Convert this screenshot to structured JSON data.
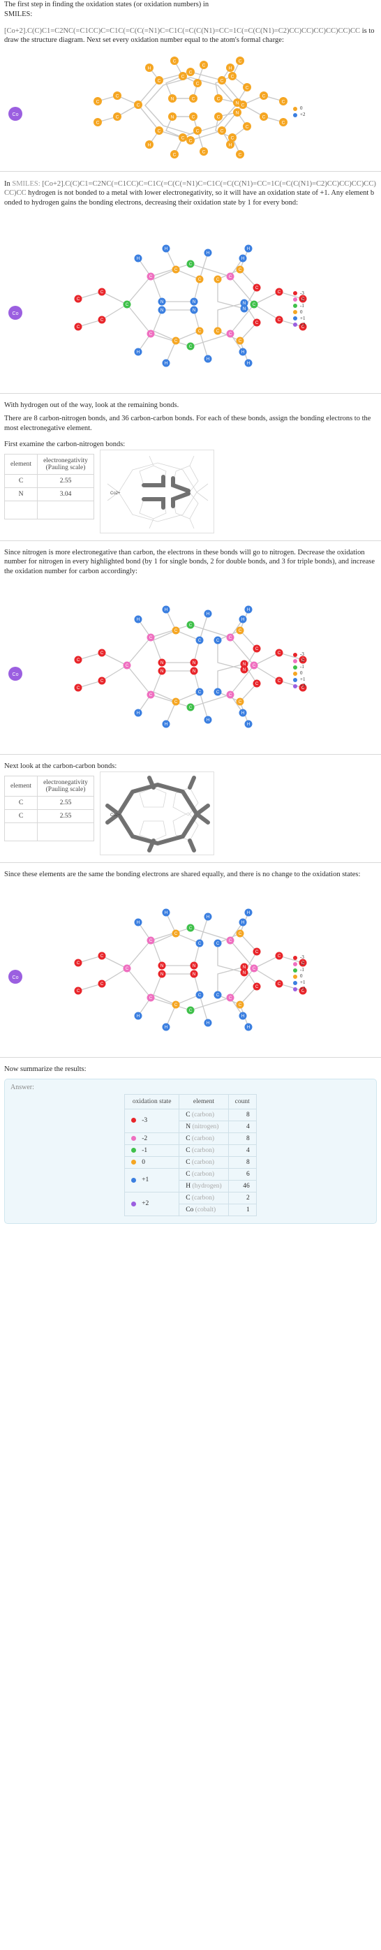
{
  "steps": {
    "step1": {
      "intro": "The first step in finding the oxidation states (or oxidation numbers) in",
      "smiles_label": "SMILES:",
      "smiles": "[Co+2].C(C)C1=C2NC(=C1CC)C=C1C(=C(C(=N1)C=C1C(=C(C(N1)=CC=1C(=C(C(N1)=C2)CC)CC)CC)CC)CC)CC",
      "tail": "is to draw the structure diagram. Next set every oxidation number equal to the atom's formal charge:"
    },
    "step2": {
      "line1_a": "In",
      "line1_smiles_label": "SMILES:",
      "line1_smiles": "[Co+2].C(C)C1=C2NC(=C1CC)C=C1C(=C(C(=N1)C=C1C(=C(C(N1)=CC=1C(=C(C(N1)=C2)CC)CC)CC)CC)CC)CC",
      "line1_b": "hydrogen is not bonded to a metal with lower electronegativity, so it will have an oxidation state of +1. Any element bonded to hydrogen gains the bonding electrons, decreasing their oxidation state by 1 for every bond:"
    },
    "step3": {
      "p1": "With hydrogen out of the way, look at the remaining bonds.",
      "p2": "There are 8 carbon-nitrogen bonds, and 36 carbon-carbon bonds.  For each of these bonds, assign the bonding electrons to the most electronegative element.",
      "p3": "First examine the carbon-nitrogen bonds:"
    },
    "step4": {
      "p1": "Since nitrogen is more electronegative than carbon, the electrons in these bonds will go to nitrogen. Decrease the oxidation number for nitrogen in every highlighted bond (by 1 for single bonds, 2 for double bonds, and 3 for triple bonds), and increase the oxidation number for carbon accordingly:"
    },
    "step5": {
      "p1": "Next look at the carbon-carbon bonds:"
    },
    "step6": {
      "p1": "Since these elements are the same the bonding electrons are shared equally, and there is no change to the oxidation states:"
    },
    "step7": {
      "p1": "Now summarize the results:"
    }
  },
  "en_table_cn": {
    "headers": [
      "element",
      "electronegativity\n(Pauling scale)"
    ],
    "header_col1": "element",
    "header_col2_line1": "electronegativity",
    "header_col2_line2": "(Pauling scale)",
    "rows": [
      {
        "element": "C",
        "value": "2.55"
      },
      {
        "element": "N",
        "value": "3.04"
      }
    ],
    "figure_label": "Co2+"
  },
  "en_table_cc": {
    "header_col1": "element",
    "header_col2_line1": "electronegativity",
    "header_col2_line2": "(Pauling scale)",
    "rows": [
      {
        "element": "C",
        "value": "2.55"
      },
      {
        "element": "C",
        "value": "2.55"
      }
    ],
    "figure_label": "Co2+"
  },
  "legend_initial": [
    {
      "color": "#f5a623",
      "label": "0"
    },
    {
      "color": "#3b7fe0",
      "label": "+2"
    }
  ],
  "legend_full": [
    {
      "color": "#e8252a",
      "label": "-3"
    },
    {
      "color": "#ef6fc0",
      "label": "-2"
    },
    {
      "color": "#3fc04a",
      "label": "-1"
    },
    {
      "color": "#f5a623",
      "label": "0"
    },
    {
      "color": "#3b7fe0",
      "label": "+1"
    },
    {
      "color": "#9b5fe0",
      "label": "+2"
    }
  ],
  "answer": {
    "label": "Answer:",
    "headers": {
      "ox": "oxidation state",
      "element": "element",
      "count": "count"
    },
    "groups": [
      {
        "color": "#e8252a",
        "state": "-3",
        "rows": [
          {
            "sym": "C",
            "name": "(carbon)",
            "count": "8"
          },
          {
            "sym": "N",
            "name": "(nitrogen)",
            "count": "4"
          }
        ]
      },
      {
        "color": "#ef6fc0",
        "state": "-2",
        "rows": [
          {
            "sym": "C",
            "name": "(carbon)",
            "count": "8"
          }
        ]
      },
      {
        "color": "#3fc04a",
        "state": "-1",
        "rows": [
          {
            "sym": "C",
            "name": "(carbon)",
            "count": "4"
          }
        ]
      },
      {
        "color": "#f5a623",
        "state": "0",
        "rows": [
          {
            "sym": "C",
            "name": "(carbon)",
            "count": "8"
          }
        ]
      },
      {
        "color": "#3b7fe0",
        "state": "+1",
        "rows": [
          {
            "sym": "C",
            "name": "(carbon)",
            "count": "6"
          },
          {
            "sym": "H",
            "name": "(hydrogen)",
            "count": "46"
          }
        ]
      },
      {
        "color": "#9b5fe0",
        "state": "+2",
        "rows": [
          {
            "sym": "C",
            "name": "(carbon)",
            "count": "2"
          },
          {
            "sym": "Co",
            "name": "(cobalt)",
            "count": "1"
          }
        ]
      }
    ]
  },
  "atom_colors": {
    "orange": "#f5a623",
    "blue": "#3b7fe0",
    "red": "#e8252a",
    "pink": "#ef6fc0",
    "green": "#3fc04a",
    "purple": "#9b5fe0",
    "bond": "#b8b8b8",
    "metal": "#9b5fe0"
  }
}
